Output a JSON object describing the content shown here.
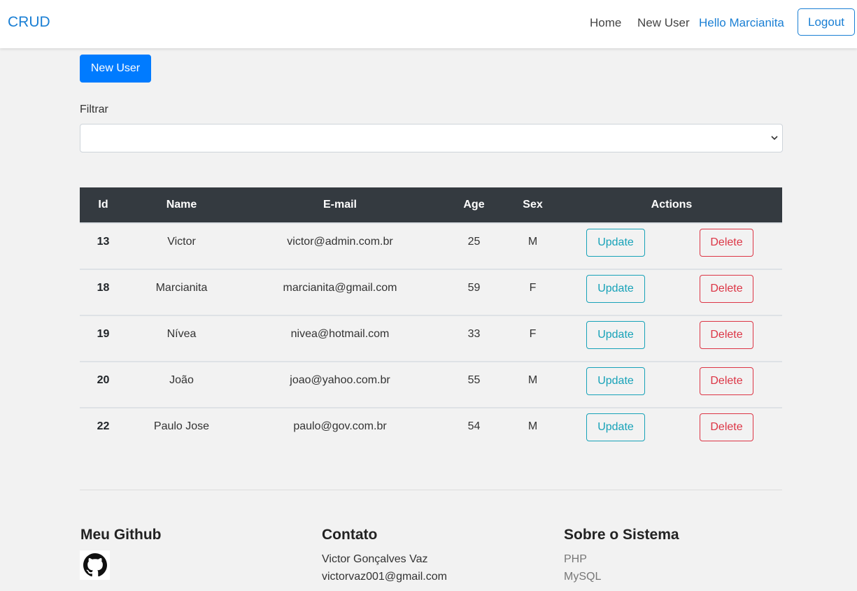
{
  "navbar": {
    "brand": "CRUD",
    "home": "Home",
    "new_user": "New User",
    "hello": "Hello Marcianita",
    "logout": "Logout"
  },
  "main": {
    "new_user_button": "New User",
    "filter_label": "Filtrar",
    "filter_value": ""
  },
  "table": {
    "headers": [
      "Id",
      "Name",
      "E-mail",
      "Age",
      "Sex",
      "Actions"
    ],
    "rows": [
      {
        "id": "13",
        "name": "Victor",
        "email": "victor@admin.com.br",
        "age": "25",
        "sex": "M"
      },
      {
        "id": "18",
        "name": "Marcianita",
        "email": "marcianita@gmail.com",
        "age": "59",
        "sex": "F"
      },
      {
        "id": "19",
        "name": "Nívea",
        "email": "nivea@hotmail.com",
        "age": "33",
        "sex": "F"
      },
      {
        "id": "20",
        "name": "João",
        "email": "joao@yahoo.com.br",
        "age": "55",
        "sex": "M"
      },
      {
        "id": "22",
        "name": "Paulo Jose",
        "email": "paulo@gov.com.br",
        "age": "54",
        "sex": "M"
      }
    ],
    "update_label": "Update",
    "delete_label": "Delete"
  },
  "footer": {
    "github_title": "Meu Github",
    "contact_title": "Contato",
    "contact_name": "Victor Gonçalves Vaz",
    "contact_email": "victorvaz001@gmail.com",
    "about_title": "Sobre o Sistema",
    "about_items": [
      "PHP",
      "MySQL"
    ]
  },
  "colors": {
    "primary": "#007bff",
    "link": "#1a7fd4",
    "info": "#17a2b8",
    "danger": "#dc3545",
    "table_head": "#343a40"
  },
  "icons": {
    "github": "github-icon",
    "select_chevron": "chevron-down-icon"
  }
}
